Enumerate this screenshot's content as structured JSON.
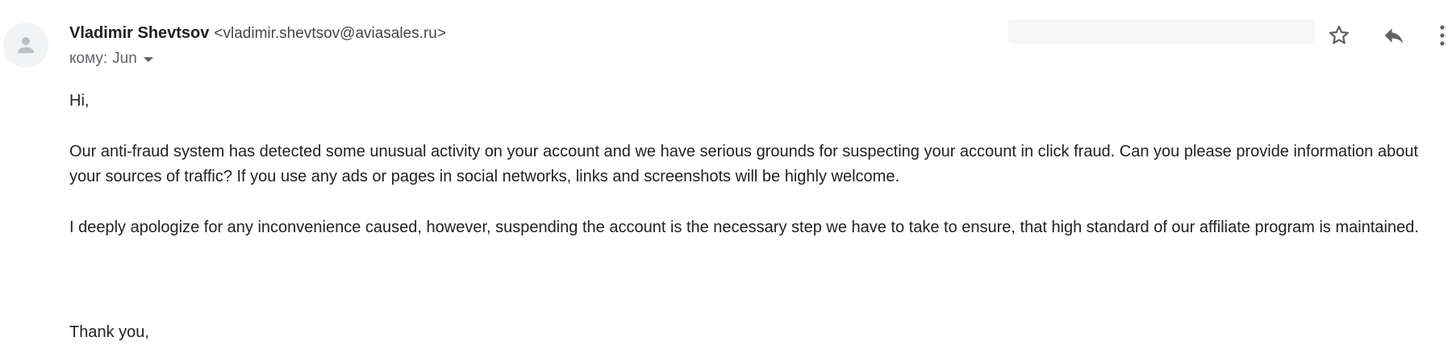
{
  "sender": {
    "name": "Vladimir Shevtsov",
    "email": "<vladimir.shevtsov@aviasales.ru>"
  },
  "recipient": {
    "label": "кому:",
    "name": "Jun"
  },
  "icons": {
    "avatar": "person-icon",
    "star": "star-outline-icon",
    "reply": "reply-icon",
    "more": "more-vertical-icon",
    "recipient_details": "caret-down-icon"
  },
  "body": {
    "greeting": "Hi,",
    "paragraph_1": "Our anti-fraud system has detected some unusual activity on your account and we have serious grounds for suspecting your account in click fraud. Can you please provide information about your sources of traffic? If you use any ads or pages in social networks, links and screenshots will be highly welcome.",
    "paragraph_2": "I deeply apologize for any inconvenience caused, however, suspending the account is the necessary step we have to take to ensure, that high standard of our affiliate program is maintained.",
    "sign_off": "Thank you,"
  },
  "colors": {
    "icon": "#5f6368",
    "avatar_bg": "#f1f3f4",
    "avatar_fg": "#bdc1c6"
  }
}
